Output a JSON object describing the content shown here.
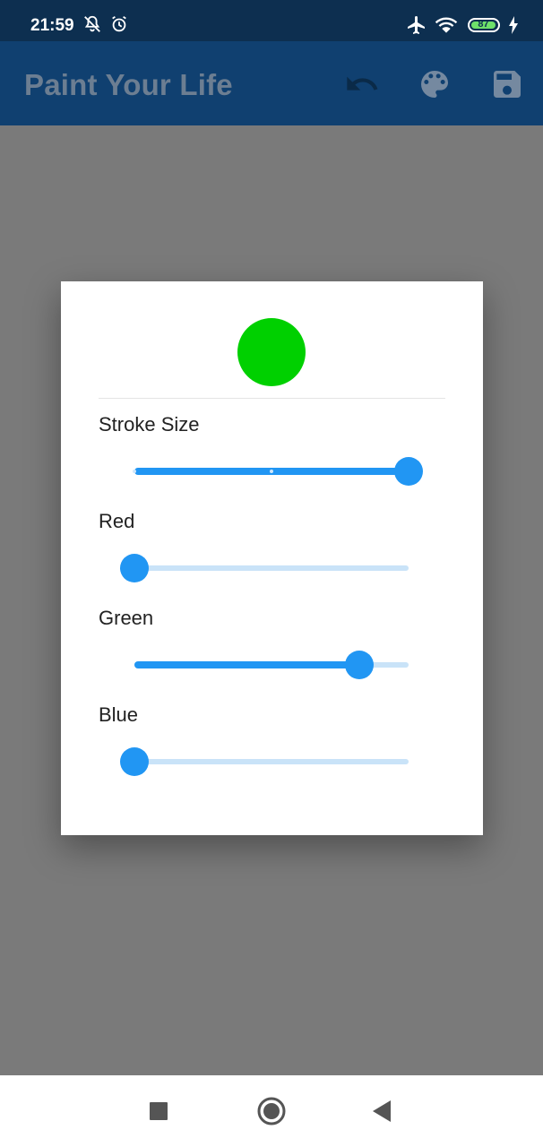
{
  "status_bar": {
    "time": "21:59",
    "battery": "87"
  },
  "app_bar": {
    "title": "Paint Your Life",
    "actions": [
      "undo-icon",
      "palette-icon",
      "save-icon"
    ]
  },
  "dialog": {
    "preview_color": "#00d000",
    "sliders": [
      {
        "label": "Stroke Size",
        "value_fraction": 1.0,
        "divisions": 2
      },
      {
        "label": "Red",
        "value_fraction": 0.0
      },
      {
        "label": "Green",
        "value_fraction": 0.82
      },
      {
        "label": "Blue",
        "value_fraction": 0.0
      }
    ]
  },
  "colors": {
    "status_bar": "#0d2f50",
    "app_bar": "#104070",
    "slider_active": "#2196f3",
    "slider_inactive": "#c9e3f8",
    "scrim": "#7a7a7a"
  },
  "nav_bar": {
    "buttons": [
      "recent-apps-icon",
      "home-icon",
      "back-icon"
    ]
  }
}
